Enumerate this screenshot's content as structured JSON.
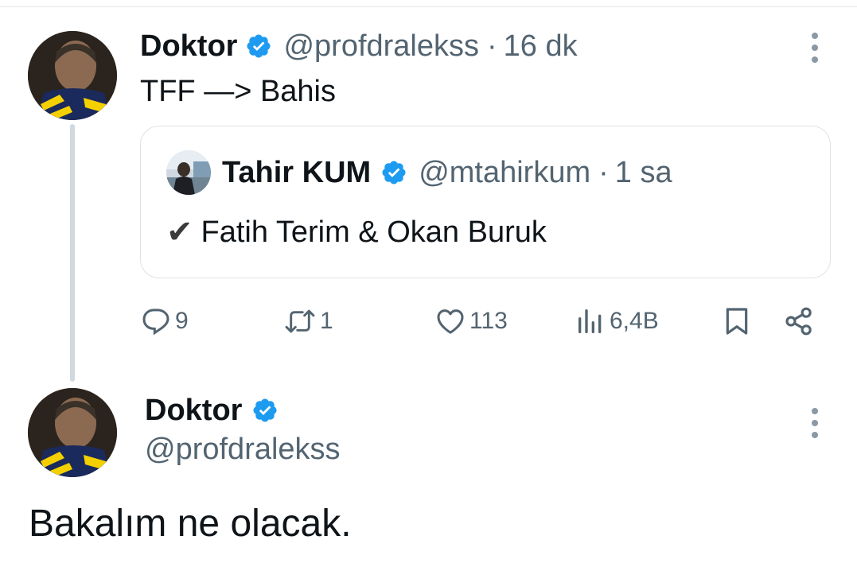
{
  "tweet1": {
    "author_name": "Doktor",
    "handle": "@profdralekss",
    "separator": "·",
    "time": "16 dk",
    "text": "TFF —> Bahis",
    "quote": {
      "author_name": "Tahir KUM",
      "handle": "@mtahirkum",
      "separator": "·",
      "time": "1 sa",
      "check": "✔",
      "text": "Fatih Terim & Okan Buruk"
    },
    "actions": {
      "replies": "9",
      "reposts": "1",
      "likes": "113",
      "views": "6,4B"
    }
  },
  "tweet2": {
    "author_name": "Doktor",
    "handle": "@profdralekss",
    "text": "Bakalım ne olacak."
  },
  "colors": {
    "verified": "#1d9bf0",
    "secondary_text": "#536471",
    "border": "#dde3e7",
    "thread_line": "#cfd9de"
  },
  "icons": [
    "verified-badge-icon",
    "more-icon",
    "reply-icon",
    "repost-icon",
    "like-icon",
    "views-icon",
    "bookmark-icon",
    "share-icon"
  ]
}
